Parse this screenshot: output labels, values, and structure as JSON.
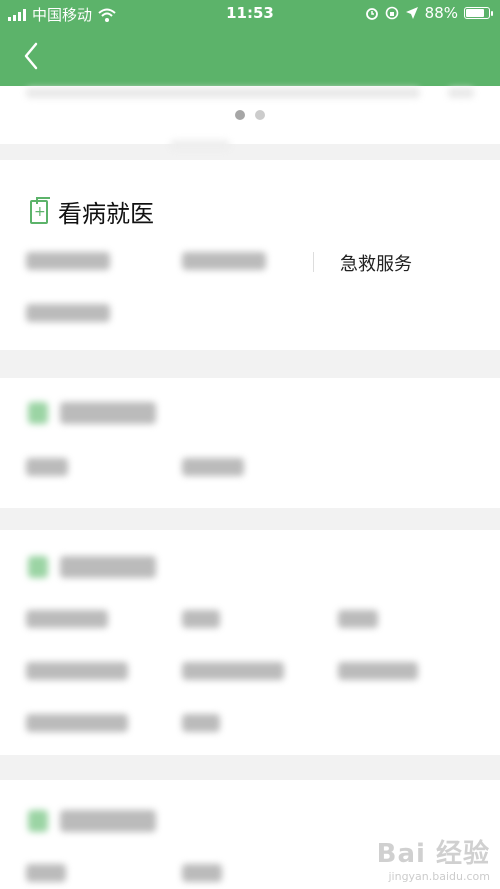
{
  "status_bar": {
    "carrier": "中国移动",
    "time": "11:53",
    "battery": "88%",
    "battery_level": 0.88
  },
  "header": {
    "back_icon": "chevron-left-icon"
  },
  "carousel": {
    "page_count": 2,
    "active_index": 0
  },
  "section_medical": {
    "title": "看病就医",
    "emergency_label": "急救服务"
  },
  "watermark": {
    "main": "Bai 经验",
    "sub": "jingyan.baidu.com"
  },
  "colors": {
    "brand_green": "#5cb36a"
  }
}
